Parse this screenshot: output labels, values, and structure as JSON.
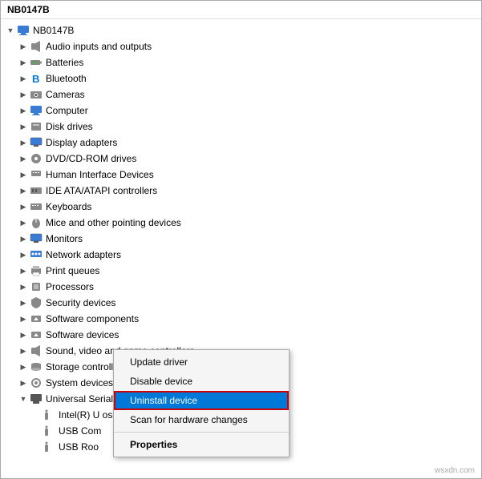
{
  "title": "NB0147B",
  "tree": [
    {
      "id": "root",
      "label": "NB0147B",
      "indent": 0,
      "expander": "v",
      "icon": "💻",
      "iconClass": "icon-computer"
    },
    {
      "id": "audio",
      "label": "Audio inputs and outputs",
      "indent": 1,
      "expander": ">",
      "icon": "🔊",
      "iconClass": "icon-sound"
    },
    {
      "id": "batteries",
      "label": "Batteries",
      "indent": 1,
      "expander": ">",
      "icon": "🔋",
      "iconClass": "icon-battery"
    },
    {
      "id": "bluetooth",
      "label": "Bluetooth",
      "indent": 1,
      "expander": ">",
      "icon": "⬡",
      "iconClass": "icon-bt"
    },
    {
      "id": "cameras",
      "label": "Cameras",
      "indent": 1,
      "expander": ">",
      "icon": "📷",
      "iconClass": "icon-camera"
    },
    {
      "id": "computer",
      "label": "Computer",
      "indent": 1,
      "expander": ">",
      "icon": "🖥",
      "iconClass": "icon-computer"
    },
    {
      "id": "disk",
      "label": "Disk drives",
      "indent": 1,
      "expander": ">",
      "icon": "💾",
      "iconClass": "icon-disk"
    },
    {
      "id": "display",
      "label": "Display adapters",
      "indent": 1,
      "expander": ">",
      "icon": "🖥",
      "iconClass": "icon-display"
    },
    {
      "id": "dvd",
      "label": "DVD/CD-ROM drives",
      "indent": 1,
      "expander": ">",
      "icon": "💿",
      "iconClass": "icon-dvd"
    },
    {
      "id": "hid",
      "label": "Human Interface Devices",
      "indent": 1,
      "expander": ">",
      "icon": "⌨",
      "iconClass": "icon-hid"
    },
    {
      "id": "ide",
      "label": "IDE ATA/ATAPI controllers",
      "indent": 1,
      "expander": ">",
      "icon": "🔧",
      "iconClass": "icon-ide"
    },
    {
      "id": "keyboards",
      "label": "Keyboards",
      "indent": 1,
      "expander": ">",
      "icon": "⌨",
      "iconClass": "icon-keyboard"
    },
    {
      "id": "mice",
      "label": "Mice and other pointing devices",
      "indent": 1,
      "expander": ">",
      "icon": "🖱",
      "iconClass": "icon-mice"
    },
    {
      "id": "monitors",
      "label": "Monitors",
      "indent": 1,
      "expander": ">",
      "icon": "🖥",
      "iconClass": "icon-monitor"
    },
    {
      "id": "network",
      "label": "Network adapters",
      "indent": 1,
      "expander": ">",
      "icon": "🌐",
      "iconClass": "icon-network"
    },
    {
      "id": "print",
      "label": "Print queues",
      "indent": 1,
      "expander": ">",
      "icon": "🖨",
      "iconClass": "icon-print"
    },
    {
      "id": "proc",
      "label": "Processors",
      "indent": 1,
      "expander": ">",
      "icon": "⚙",
      "iconClass": "icon-proc"
    },
    {
      "id": "security",
      "label": "Security devices",
      "indent": 1,
      "expander": ">",
      "icon": "🔒",
      "iconClass": "icon-security"
    },
    {
      "id": "swcomp",
      "label": "Software components",
      "indent": 1,
      "expander": ">",
      "icon": "📦",
      "iconClass": "icon-sw"
    },
    {
      "id": "swdev",
      "label": "Software devices",
      "indent": 1,
      "expander": ">",
      "icon": "📦",
      "iconClass": "icon-sw"
    },
    {
      "id": "sound",
      "label": "Sound, video and game controllers",
      "indent": 1,
      "expander": ">",
      "icon": "🔊",
      "iconClass": "icon-sound"
    },
    {
      "id": "storage",
      "label": "Storage controllers",
      "indent": 1,
      "expander": ">",
      "icon": "💾",
      "iconClass": "icon-storage"
    },
    {
      "id": "sysdev",
      "label": "System devices",
      "indent": 1,
      "expander": ">",
      "icon": "⚙",
      "iconClass": "icon-system"
    },
    {
      "id": "usb",
      "label": "Universal Serial Bus controllers",
      "indent": 1,
      "expander": "v",
      "icon": "🔌",
      "iconClass": "icon-usb-ctrl"
    },
    {
      "id": "intel",
      "label": "Intel(R) U                       osoft)",
      "indent": 2,
      "expander": "",
      "icon": "🔌",
      "iconClass": "icon-usb"
    },
    {
      "id": "usbcom",
      "label": "USB Com",
      "indent": 2,
      "expander": "",
      "icon": "🔌",
      "iconClass": "icon-usb"
    },
    {
      "id": "usbroot",
      "label": "USB Roo",
      "indent": 2,
      "expander": "",
      "icon": "🔌",
      "iconClass": "icon-usb"
    }
  ],
  "context_menu": {
    "items": [
      {
        "id": "update",
        "label": "Update driver",
        "bold": false,
        "highlighted": false
      },
      {
        "id": "disable",
        "label": "Disable device",
        "bold": false,
        "highlighted": false
      },
      {
        "id": "uninstall",
        "label": "Uninstall device",
        "bold": false,
        "highlighted": true
      },
      {
        "id": "scan",
        "label": "Scan for hardware changes",
        "bold": false,
        "highlighted": false
      },
      {
        "id": "properties",
        "label": "Properties",
        "bold": true,
        "highlighted": false
      }
    ]
  },
  "watermark": "wsxdn.com"
}
